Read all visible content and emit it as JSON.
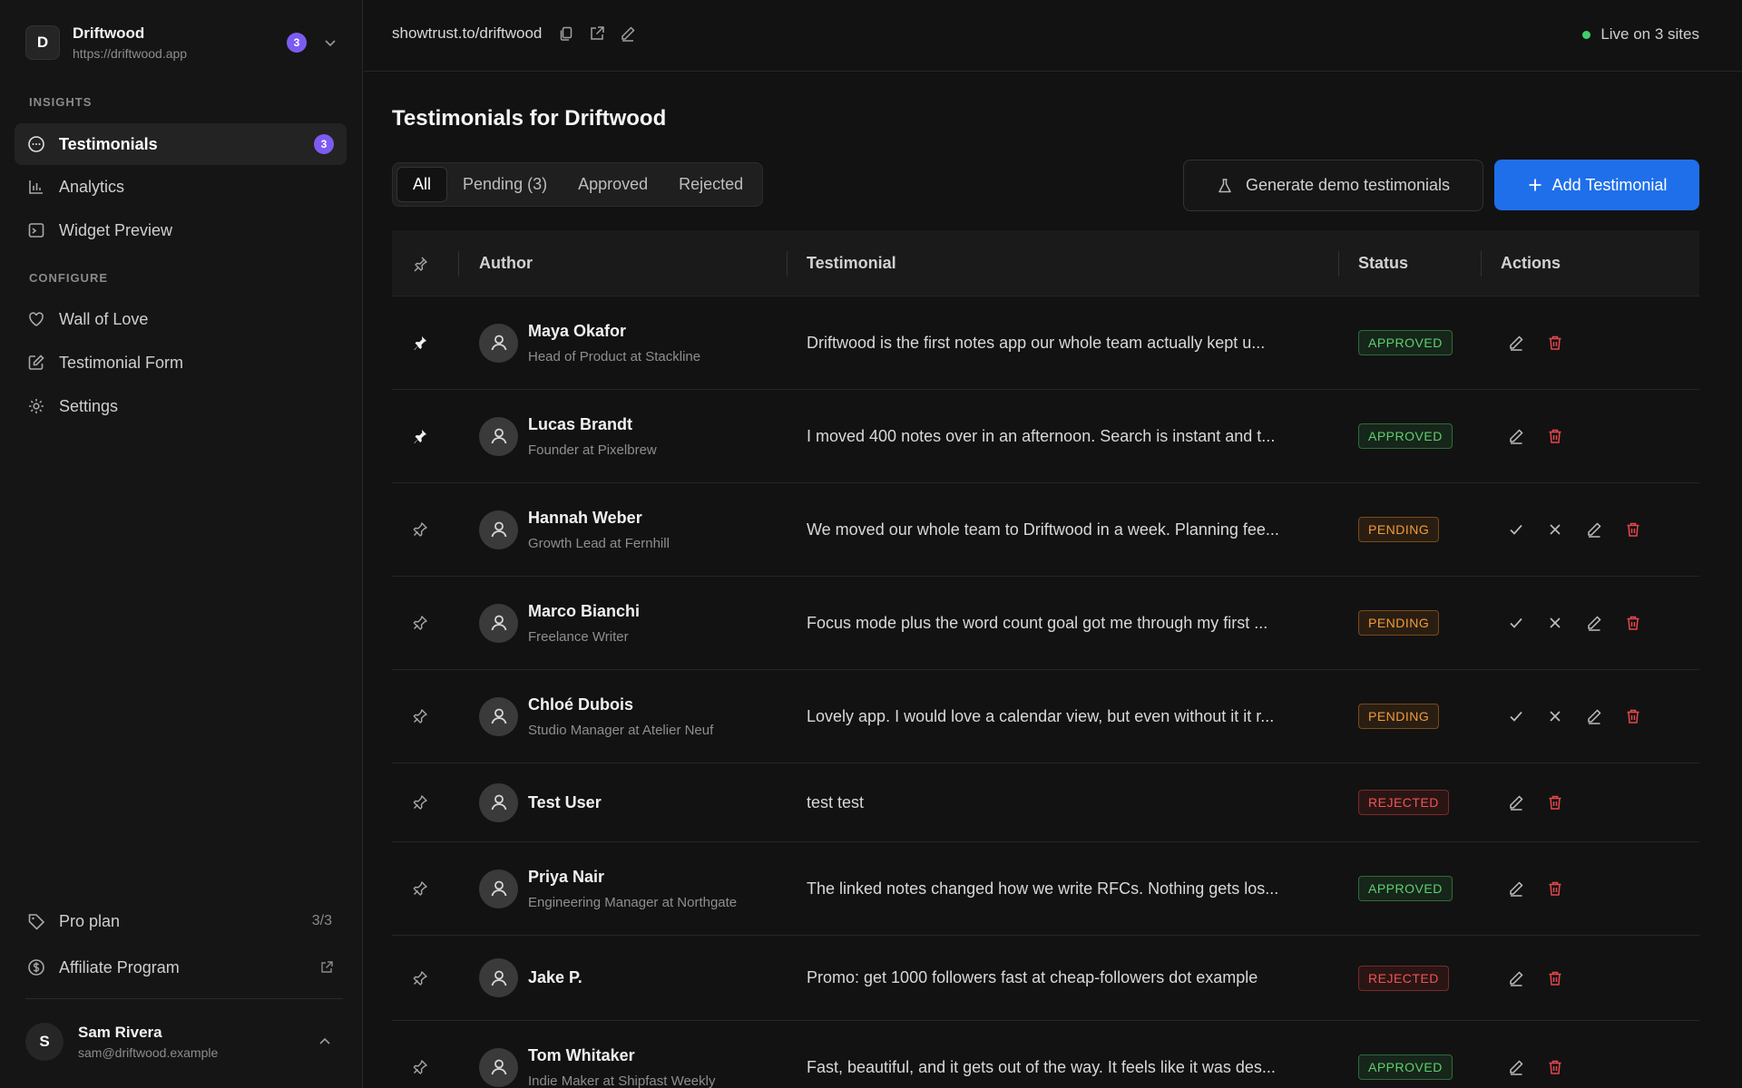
{
  "workspace": {
    "initial": "D",
    "name": "Driftwood",
    "url": "https://driftwood.app",
    "badge": "3"
  },
  "sidebar": {
    "insights_label": "INSIGHTS",
    "configure_label": "CONFIGURE",
    "testimonials": {
      "label": "Testimonials",
      "badge": "3"
    },
    "analytics": "Analytics",
    "widget_preview": "Widget Preview",
    "wall_of_love": "Wall of Love",
    "testimonial_form": "Testimonial Form",
    "settings": "Settings",
    "pro_plan": {
      "label": "Pro plan",
      "count": "3/3"
    },
    "affiliate": "Affiliate Program"
  },
  "user": {
    "initial": "S",
    "name": "Sam Rivera",
    "email": "sam@driftwood.example"
  },
  "topbar": {
    "share_url": "showtrust.to/driftwood",
    "live_status": "Live on 3 sites"
  },
  "page": {
    "title": "Testimonials for Driftwood"
  },
  "tabs": {
    "all": "All",
    "pending": "Pending (3)",
    "approved": "Approved",
    "rejected": "Rejected"
  },
  "buttons": {
    "demo": "Generate demo testimonials",
    "add": "Add Testimonial"
  },
  "table": {
    "headers": {
      "author": "Author",
      "testimonial": "Testimonial",
      "status": "Status",
      "actions": "Actions"
    },
    "rows": [
      {
        "name": "Maya Okafor",
        "role": "Head of Product at Stackline",
        "text": "Driftwood is the first notes app our whole team actually kept u...",
        "status": "APPROVED"
      },
      {
        "name": "Lucas Brandt",
        "role": "Founder at Pixelbrew",
        "text": "I moved 400 notes over in an afternoon. Search is instant and t...",
        "status": "APPROVED"
      },
      {
        "name": "Hannah Weber",
        "role": "Growth Lead at Fernhill",
        "text": "We moved our whole team to Driftwood in a week. Planning fee...",
        "status": "PENDING"
      },
      {
        "name": "Marco Bianchi",
        "role": "Freelance Writer",
        "text": "Focus mode plus the word count goal got me through my first ...",
        "status": "PENDING"
      },
      {
        "name": "Chloé Dubois",
        "role": "Studio Manager at Atelier Neuf",
        "text": "Lovely app. I would love a calendar view, but even without it it r...",
        "status": "PENDING"
      },
      {
        "name": "Test User",
        "role": "",
        "text": "test test",
        "status": "REJECTED"
      },
      {
        "name": "Priya Nair",
        "role": "Engineering Manager at Northgate",
        "text": "The linked notes changed how we write RFCs. Nothing gets los...",
        "status": "APPROVED"
      },
      {
        "name": "Jake P.",
        "role": "",
        "text": "Promo: get 1000 followers fast at cheap-followers dot example",
        "status": "REJECTED"
      },
      {
        "name": "Tom Whitaker",
        "role": "Indie Maker at Shipfast Weekly",
        "text": "Fast, beautiful, and it gets out of the way. It feels like it was des...",
        "status": "APPROVED"
      }
    ]
  },
  "colors": {
    "accent": "#1f6feb",
    "badge": "#7c5cf0",
    "approved": "#5fcf6e",
    "pending": "#f39a3a",
    "rejected": "#f05454",
    "live": "#3fcf6b"
  }
}
